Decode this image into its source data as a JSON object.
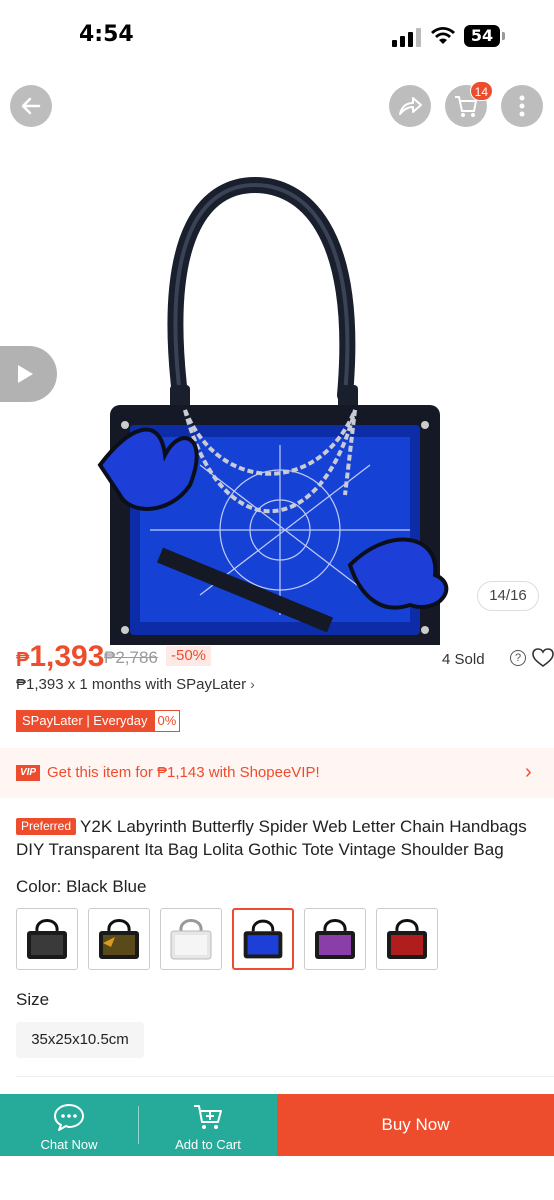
{
  "status_bar": {
    "time": "4:54",
    "battery": "54"
  },
  "header": {
    "cart_count": "14"
  },
  "gallery": {
    "counter": "14/16"
  },
  "price": {
    "currency": "₱",
    "current": "1,393",
    "original": "₱2,786",
    "discount": "-50%",
    "sold": "4 Sold"
  },
  "installment": {
    "text": "₱1,393 x 1 months with SPayLater"
  },
  "spaylater_tag": {
    "label": "SPayLater | Everyday",
    "rate": "0%"
  },
  "vip": {
    "icon": "VIP",
    "text": "Get this item for ₱1,143 with ShopeeVIP!"
  },
  "product": {
    "badge": "Preferred",
    "title": "Y2K Labyrinth Butterfly Spider Web Letter Chain Handbags DIY Transparent Ita Bag Lolita Gothic Tote Vintage Shoulder Bag"
  },
  "color": {
    "label": "Color:",
    "selected": "Black Blue",
    "selected_index": 3
  },
  "size": {
    "label": "Size",
    "option": "35x25x10.5cm"
  },
  "bottom_bar": {
    "chat": "Chat Now",
    "add_to_cart": "Add to Cart",
    "buy_now": "Buy Now"
  },
  "colors": {
    "accent": "#ee4d2d",
    "green": "#26aa99"
  }
}
